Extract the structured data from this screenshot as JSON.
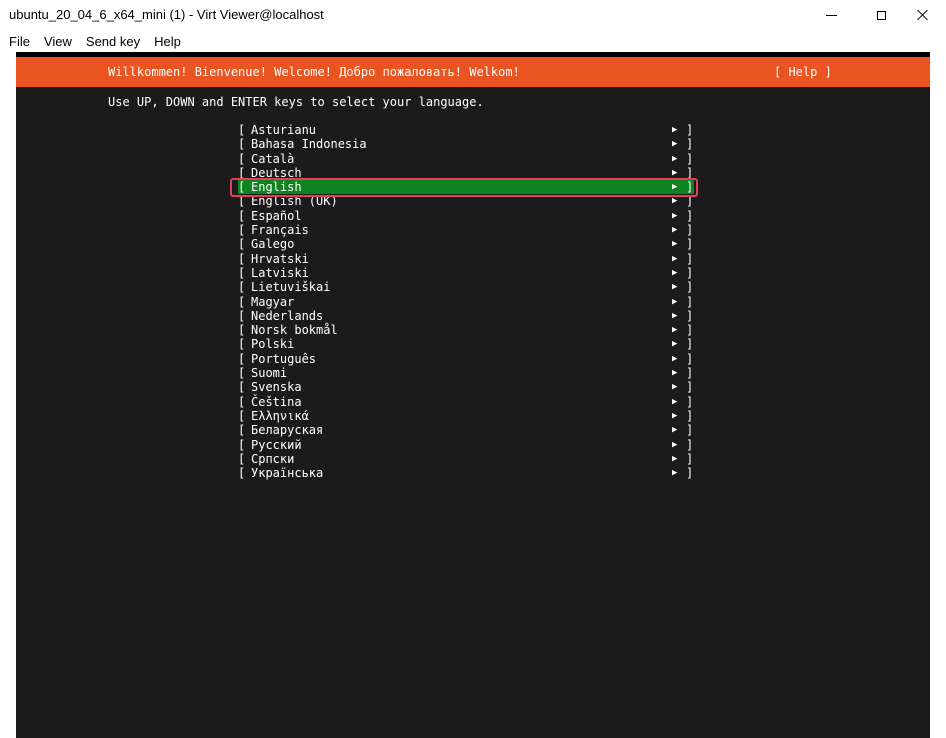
{
  "window": {
    "title": "ubuntu_20_04_6_x64_mini (1) - Virt Viewer@localhost",
    "controls": {
      "minimize": "minimize-icon",
      "maximize": "maximize-icon",
      "close": "close-icon"
    }
  },
  "menu": [
    {
      "label": "File"
    },
    {
      "label": "View"
    },
    {
      "label": "Send key"
    },
    {
      "label": "Help"
    }
  ],
  "installer": {
    "header_welcome": "Willkommen! Bienvenue! Welcome! Добро пожаловать! Welkom!",
    "help_button": "[ Help ]",
    "instruction": "Use UP, DOWN and ENTER keys to select your language.",
    "bracket_open": "[",
    "bracket_close": "]",
    "arrow": "▶",
    "selected_index": 4,
    "languages": [
      "Asturianu",
      "Bahasa Indonesia",
      "Català",
      "Deutsch",
      "English",
      "English (UK)",
      "Español",
      "Français",
      "Galego",
      "Hrvatski",
      "Latviski",
      "Lietuviškai",
      "Magyar",
      "Nederlands",
      "Norsk bokmål",
      "Polski",
      "Português",
      "Suomi",
      "Svenska",
      "Čeština",
      "Ελληνικά",
      "Беларуская",
      "Русский",
      "Српски",
      "Українська"
    ]
  },
  "colors": {
    "header": "#e95420",
    "selected": "#0e8420",
    "screen_bg": "#1b1b1b",
    "annotation_box": "#e0405a"
  }
}
